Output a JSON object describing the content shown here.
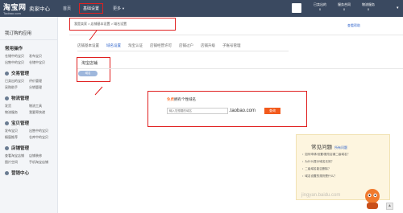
{
  "header": {
    "logo_text": "淘宝网",
    "logo_domain": "Taobao.com",
    "logo_sub": "卖家中心",
    "nav": [
      {
        "label": "首页"
      },
      {
        "label": "基础设置"
      },
      {
        "label": "更多"
      }
    ],
    "stats": [
      {
        "label": "已卖出的",
        "value": "0"
      },
      {
        "label": "服务合同",
        "value": "0"
      },
      {
        "label": "物流服务",
        "value": "0"
      }
    ]
  },
  "sidebar": {
    "heading": "我订购的应用",
    "sections": [
      {
        "title": "常用操作",
        "items": [
          "仓储中的宝贝",
          "发布宝贝",
          "出售中的宝贝",
          "仓储中宝贝"
        ]
      },
      {
        "title": "交易管理",
        "items": [
          "已卖出的宝贝",
          "评价管理",
          "采购助手",
          "分销管理"
        ]
      },
      {
        "title": "物流管理",
        "items": [
          "发货",
          "物流工具",
          "物流服务",
          "我要寄快递"
        ]
      },
      {
        "title": "宝贝管理",
        "items": [
          "发布宝贝",
          "出售中的宝贝",
          "橱窗推荐",
          "仓库中的宝贝"
        ]
      },
      {
        "title": "店铺管理",
        "items": [
          "查看淘宝店铺",
          "店铺装修",
          "图片空间",
          "手机淘宝店铺"
        ]
      },
      {
        "title": "营销中心",
        "items": []
      }
    ]
  },
  "main": {
    "breadcrumb": "我是卖家 > 店铺基本设置 > 域名设置",
    "help_link": "查看帮助",
    "tabs": [
      "店铺基本设置",
      "域名设置",
      "淘宝认证",
      "店铺经营许可",
      "店铺过户",
      "店铺升级",
      "子账号管理"
    ],
    "active_tab": "域名设置",
    "shop_title": "淘宝店铺",
    "shop_tag": "域名",
    "domain_free": "免费",
    "domain_title_rest": "拥有个性域名",
    "domain_placeholder": "输入您想要的域名",
    "domain_suffix": ".taobao.com",
    "query_button": "查询"
  },
  "faq": {
    "title": "常见问题",
    "more": "所有问题",
    "items": [
      "如何申请/设置/更改店铺二级域名？",
      "为什么提示域名无效？",
      "二级域名能否删除？",
      "域名设置的规则是什么？"
    ]
  },
  "watermark": "jingyan.baidu.com"
}
